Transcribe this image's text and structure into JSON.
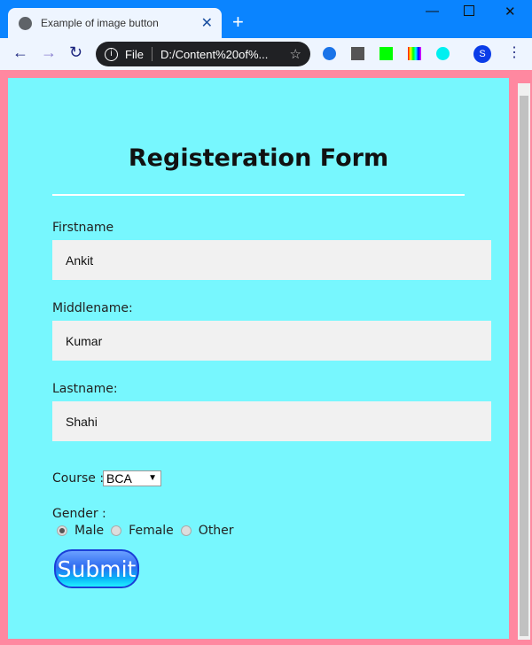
{
  "browser": {
    "tab_title": "Example of image button",
    "omnibox_scheme": "File",
    "omnibox_url": "D:/Content%20of%...",
    "profile_initial": "S"
  },
  "form": {
    "title": "Registeration Form",
    "fields": [
      {
        "label": "Firstname",
        "value": "Ankit"
      },
      {
        "label": "Middlename:",
        "value": "Kumar"
      },
      {
        "label": "Lastname:",
        "value": "Shahi"
      }
    ],
    "course_label": "Course :",
    "course_value": "BCA",
    "gender_label": "Gender :",
    "gender_options": [
      "Male",
      "Female",
      "Other"
    ],
    "gender_selected": "Male",
    "submit_label": "Submit"
  },
  "colors": {
    "page_bg": "#77f7fe",
    "frame": "#ff88a0",
    "titlebar": "#0a84ff"
  }
}
